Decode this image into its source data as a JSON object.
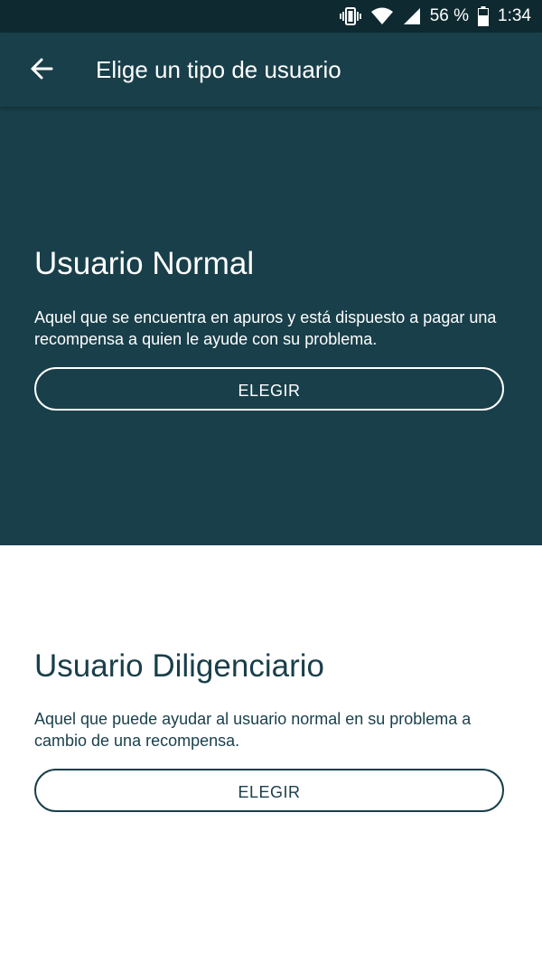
{
  "status_bar": {
    "battery_percent": "56 %",
    "time": "1:34",
    "icons": [
      "vibrate-icon",
      "wifi-icon",
      "signal-icon",
      "battery-icon"
    ]
  },
  "app_bar": {
    "title": "Elige un tipo de usuario",
    "back_icon": "arrow-left-icon"
  },
  "options": {
    "normal": {
      "title": "Usuario Normal",
      "description": "Aquel que se encuentra en apuros y está dispuesto a pagar una recompensa a quien le ayude con su problema.",
      "button_label": "ELEGIR"
    },
    "diligenciario": {
      "title": "Usuario Diligenciario",
      "description": "Aquel que puede ayudar al usuario normal en su problema a cambio de una recompensa.",
      "button_label": "ELEGIR"
    }
  },
  "colors": {
    "status_bar": "#0e2a30",
    "primary": "#193f4a",
    "background": "#ffffff",
    "text_on_primary": "#ffffff"
  }
}
